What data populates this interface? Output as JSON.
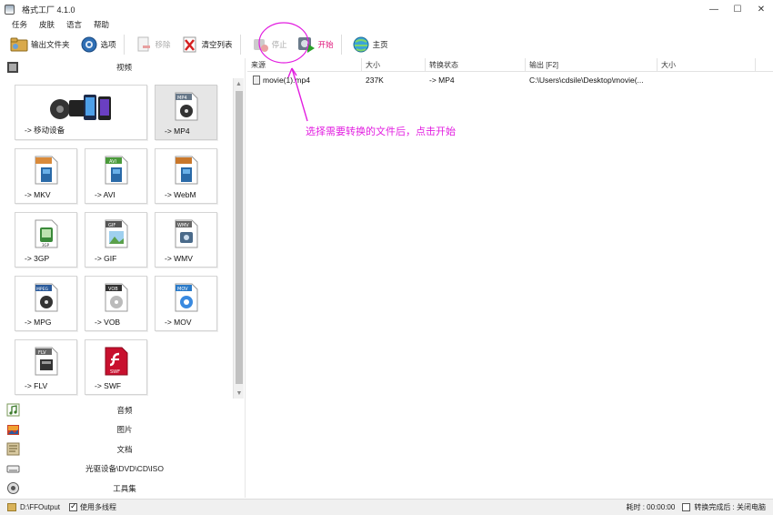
{
  "window": {
    "title": "格式工厂 4.1.0"
  },
  "menu": {
    "items": [
      "任务",
      "皮肤",
      "语言",
      "帮助"
    ]
  },
  "toolbar": {
    "output_folder": "输出文件夹",
    "options": "选项",
    "remove": "移除",
    "clear_list": "清空列表",
    "stop": "停止",
    "start": "开始",
    "home": "主页"
  },
  "sidebar": {
    "video_label": "视频",
    "tiles": [
      {
        "label": "-> 移动设备",
        "icon": "mobile-devices-icon"
      },
      {
        "label": "-> MP4",
        "badge": "MP4",
        "icon": "mp4-icon"
      },
      {
        "label": "-> MKV",
        "badge": "MKV",
        "icon": "mkv-icon"
      },
      {
        "label": "-> AVI",
        "badge": "AVI",
        "icon": "avi-icon"
      },
      {
        "label": "-> WebM",
        "badge": "WebM",
        "icon": "webm-icon"
      },
      {
        "label": "-> 3GP",
        "badge": "3GP",
        "icon": "3gp-icon"
      },
      {
        "label": "-> GIF",
        "badge": "GIF",
        "icon": "gif-icon"
      },
      {
        "label": "-> WMV",
        "badge": "WMV",
        "icon": "wmv-icon"
      },
      {
        "label": "-> MPG",
        "badge": "MPEG",
        "icon": "mpg-icon"
      },
      {
        "label": "-> VOB",
        "badge": "VOB",
        "icon": "vob-icon"
      },
      {
        "label": "-> MOV",
        "badge": "MOV",
        "icon": "mov-icon"
      },
      {
        "label": "-> FLV",
        "badge": "FLV",
        "icon": "flv-icon"
      },
      {
        "label": "-> SWF",
        "badge": "SWF",
        "icon": "swf-icon"
      }
    ],
    "categories": [
      {
        "label": "音频",
        "icon": "music-note-icon"
      },
      {
        "label": "图片",
        "icon": "picture-icon"
      },
      {
        "label": "文档",
        "icon": "document-icon"
      },
      {
        "label": "光驱设备\\DVD\\CD\\ISO",
        "icon": "disc-drive-icon"
      },
      {
        "label": "工具集",
        "icon": "tools-icon"
      }
    ]
  },
  "file_list": {
    "columns": [
      "来源",
      "大小",
      "转换状态",
      "输出 [F2]",
      "大小"
    ],
    "rows": [
      {
        "source": "movie(1).mp4",
        "size": "237K",
        "status": "-> MP4",
        "output": "C:\\Users\\cdsile\\Desktop\\movie(...",
        "out_size": ""
      }
    ]
  },
  "annotation": {
    "text": "选择需要转换的文件后，点击开始",
    "color": "#e21ee0"
  },
  "statusbar": {
    "output_path": "D:\\FFOutput",
    "multithread_label": "使用多线程",
    "multithread_checked": true,
    "elapsed_label": "耗时 : 00:00:00",
    "after_convert_label": "转换完成后 : 关闭电脑",
    "after_convert_checked": false
  },
  "colors": {
    "start_accent": "#e0157a",
    "annotation": "#e21ee0",
    "selected_tile": "#e6e6e6"
  }
}
